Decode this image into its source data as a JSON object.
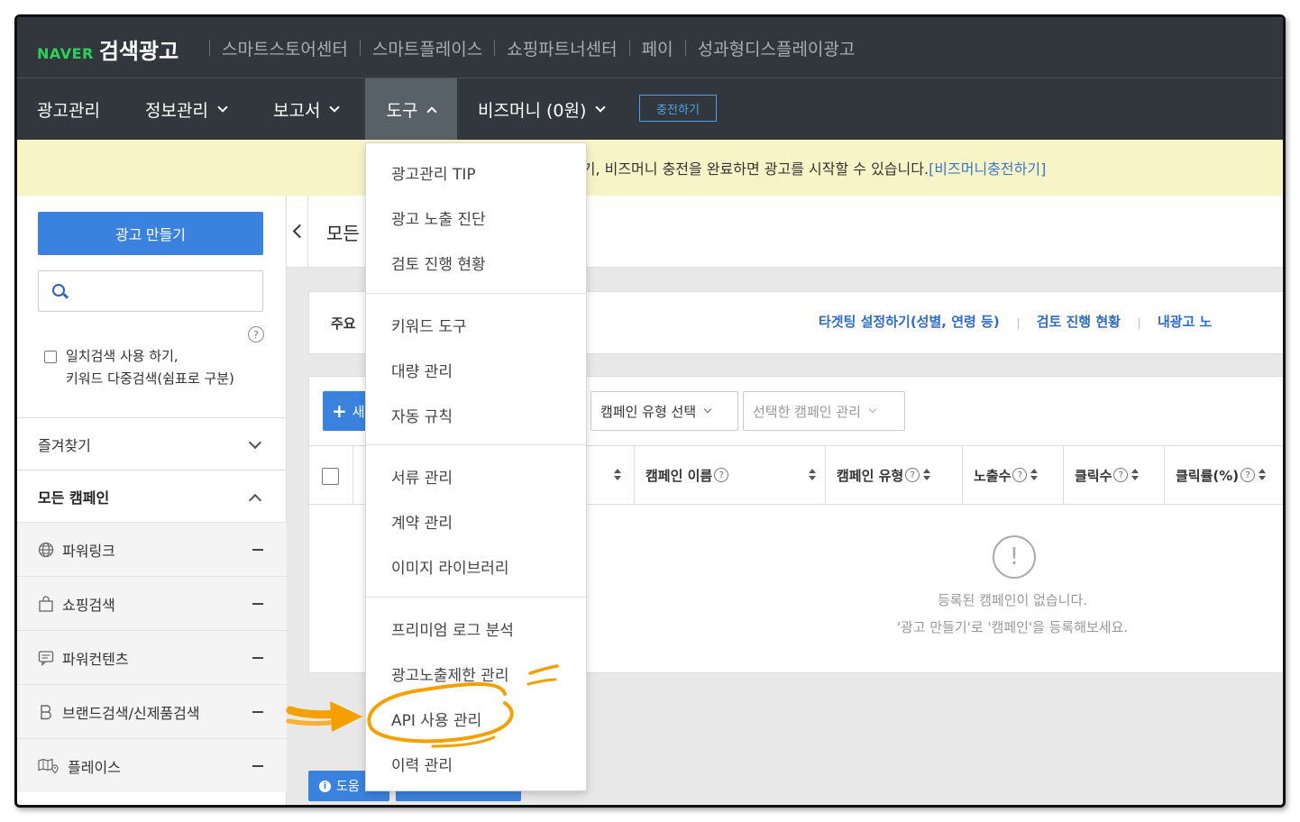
{
  "header": {
    "naver": "NAVER",
    "brand": "검색광고",
    "services": [
      "스마트스토어센터",
      "스마트플레이스",
      "쇼핑파트너센터",
      "페이",
      "성과형디스플레이광고"
    ]
  },
  "nav": {
    "items": [
      {
        "label": "광고관리"
      },
      {
        "label": "정보관리"
      },
      {
        "label": "보고서"
      },
      {
        "label": "도구"
      },
      {
        "label": "비즈머니 (0원)"
      }
    ],
    "charge_label": "충전하기"
  },
  "notice": {
    "text": "들기, 비즈머니 충전을 완료하면 광고를 시작할 수 있습니다.",
    "link": "[비즈머니충전하기]"
  },
  "sidebar": {
    "create_ad": "광고 만들기",
    "search_placeholder": "",
    "help": "?",
    "exact_line1": "일치검색 사용 하기,",
    "exact_line2": "키워드 다중검색(쉼표로 구분)",
    "favorites": "즐겨찾기",
    "all_campaigns": "모든 캠페인",
    "campaign_types": [
      {
        "label": "파워링크",
        "icon": "globe-icon"
      },
      {
        "label": "쇼핑검색",
        "icon": "shopping-bag-icon"
      },
      {
        "label": "파워컨텐츠",
        "icon": "chat-icon"
      },
      {
        "label": "브랜드검색/신제품검색",
        "icon": "brand-b-icon"
      },
      {
        "label": "플레이스",
        "icon": "map-pin-icon"
      }
    ]
  },
  "main": {
    "title": "모든",
    "key_label": "주요",
    "key_links": [
      "타겟팅 설정하기(성별, 연령 등)",
      "검토 진행 현황",
      "내광고 노"
    ],
    "new_label": "새",
    "select_type": "캠페인 유형 선택",
    "select_manage": "선택한 캠페인 관리",
    "columns": [
      "캠페인 이름",
      "캠페인 유형",
      "노출수",
      "클릭수",
      "클릭률(%)"
    ],
    "empty_icon": "!",
    "empty_line1": "등록된 캠페인이 없습니다.",
    "empty_line2": "'광고 만들기'로 '캠페인'을 등록해보세요.",
    "help_btn": "도움"
  },
  "dropdown": {
    "items": [
      "광고관리 TIP",
      "광고 노출 진단",
      "검토 진행 현황",
      "키워드 도구",
      "대량 관리",
      "자동 규칙",
      "서류 관리",
      "계약 관리",
      "이미지 라이브러리",
      "프리미엄 로그 분석",
      "광고노출제한 관리",
      "API 사용 관리",
      "이력 관리"
    ]
  },
  "colors": {
    "topbar": "#31373c",
    "active_nav": "#586068",
    "naver_green": "#2fd15b",
    "primary_blue": "#3b82de",
    "notice_bg": "#f7f5c8",
    "annotation_orange": "#f5a000"
  }
}
